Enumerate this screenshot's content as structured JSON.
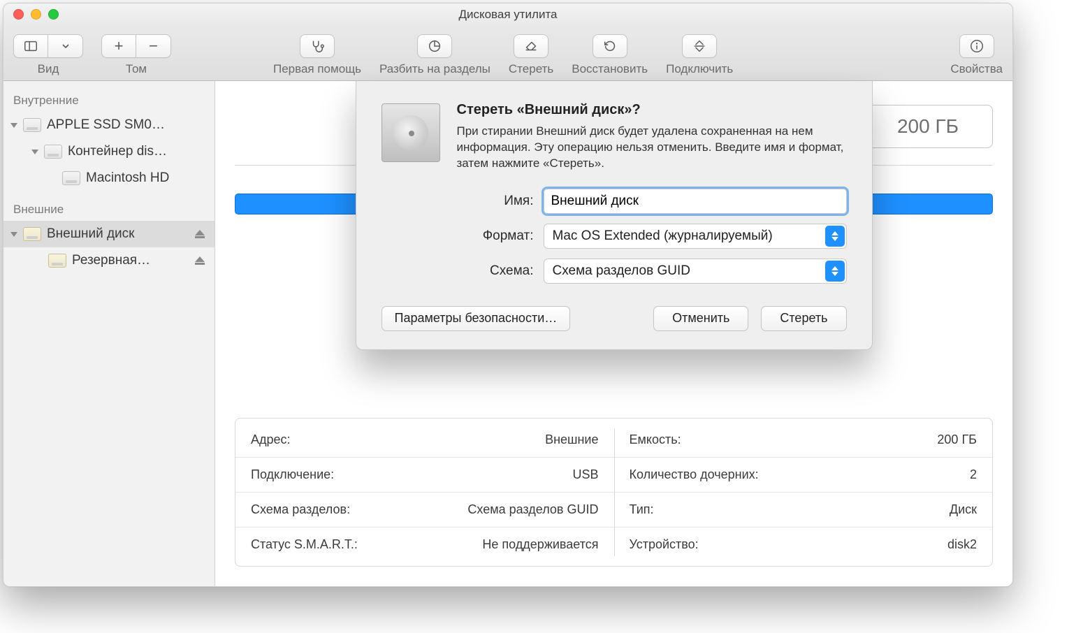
{
  "window": {
    "title": "Дисковая утилита"
  },
  "toolbar": {
    "view": "Вид",
    "volume": "Том",
    "first_aid": "Первая помощь",
    "partition": "Разбить на разделы",
    "erase": "Стереть",
    "restore": "Восстановить",
    "mount": "Подключить",
    "info": "Свойства"
  },
  "sidebar": {
    "internal_header": "Внутренние",
    "external_header": "Внешние",
    "items": {
      "internal_disk": "APPLE SSD SM0…",
      "container": "Контейнер dis…",
      "macintosh_hd": "Macintosh HD",
      "external_disk": "Внешний диск",
      "backup": "Резервная…"
    }
  },
  "main": {
    "capacity_badge": "200 ГБ"
  },
  "sheet": {
    "title": "Стереть «Внешний диск»?",
    "message": "При стирании Внешний диск будет удалена сохраненная на нем информация. Эту операцию нельзя отменить. Введите имя и формат, затем нажмите «Стереть».",
    "labels": {
      "name": "Имя:",
      "format": "Формат:",
      "scheme": "Схема:"
    },
    "values": {
      "name": "Внешний диск",
      "format": "Mac OS Extended (журналируемый)",
      "scheme": "Схема разделов GUID"
    },
    "buttons": {
      "security": "Параметры безопасности…",
      "cancel": "Отменить",
      "erase": "Стереть"
    }
  },
  "details": {
    "left": [
      {
        "k": "Адрес:",
        "v": "Внешние"
      },
      {
        "k": "Подключение:",
        "v": "USB"
      },
      {
        "k": "Схема разделов:",
        "v": "Схема разделов GUID"
      },
      {
        "k": "Статус S.M.A.R.T.:",
        "v": "Не поддерживается"
      }
    ],
    "right": [
      {
        "k": "Емкость:",
        "v": "200 ГБ"
      },
      {
        "k": "Количество дочерних:",
        "v": "2"
      },
      {
        "k": "Тип:",
        "v": "Диск"
      },
      {
        "k": "Устройство:",
        "v": "disk2"
      }
    ]
  }
}
